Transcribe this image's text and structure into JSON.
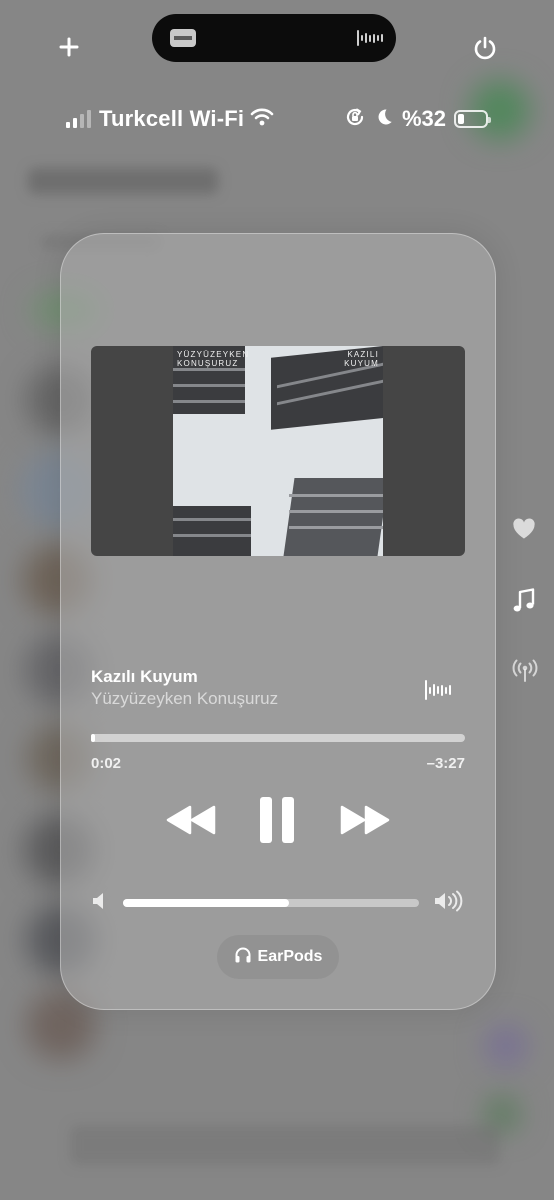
{
  "status_bar": {
    "carrier": "Turkcell Wi-Fi",
    "battery_text": "%32",
    "battery_level": 0.32,
    "signal_bars_active": 2,
    "signal_bars_total": 4,
    "icons": [
      "wifi-icon",
      "orientation-lock-icon",
      "moon-icon",
      "battery-icon"
    ]
  },
  "top_controls": {
    "left_icon": "plus-icon",
    "right_icon": "power-icon"
  },
  "dynamic_island": {
    "left_icon": "album-thumbnail-icon",
    "right_icon": "waveform-icon"
  },
  "now_playing": {
    "album_art": {
      "artist_text_line1": "YÜZYÜZEYKEN",
      "artist_text_line2": "KONUŞURUZ",
      "album_text_line1": "KAZILI",
      "album_text_line2": "KUYUM"
    },
    "track_title": "Kazılı Kuyum",
    "artist": "Yüzyüzeyken Konuşuruz",
    "elapsed": "0:02",
    "remaining": "–3:27",
    "progress": 0.01,
    "volume": 0.56,
    "controls": [
      "rewind-icon",
      "pause-icon",
      "fast-forward-icon"
    ],
    "output_device": "EarPods",
    "output_icon": "headphones-icon"
  },
  "side_shortcuts": [
    {
      "name": "heart-icon"
    },
    {
      "name": "music-note-icon"
    },
    {
      "name": "broadcast-icon"
    }
  ],
  "colors": {
    "background": "#8e8e8e",
    "card": "#afafaf",
    "accent": "#ffffff"
  }
}
